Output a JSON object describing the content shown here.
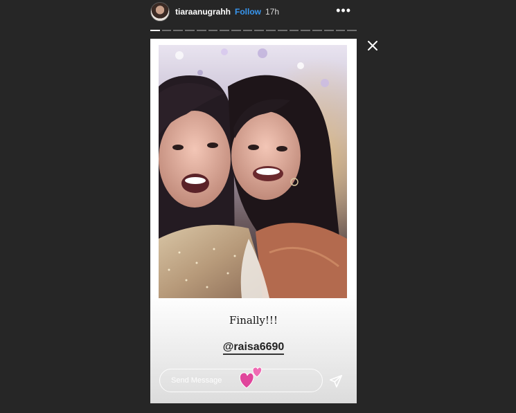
{
  "header": {
    "username": "tiaraanugrahh",
    "follow_label": "Follow",
    "time": "17h",
    "more_icon": "more-horizontal-icon",
    "more_glyph": "•••"
  },
  "progress": {
    "segments_total": 18,
    "segments_viewed": 1
  },
  "close_icon": "close-icon",
  "story": {
    "caption": "Finally!!!",
    "mention": "@raisa6690",
    "sticker_icon": "two-hearts-icon"
  },
  "reply": {
    "placeholder": "Send Message",
    "send_icon": "paper-plane-icon"
  },
  "colors": {
    "background": "#262626",
    "follow": "#3897f0",
    "heart": "#e0459b"
  }
}
